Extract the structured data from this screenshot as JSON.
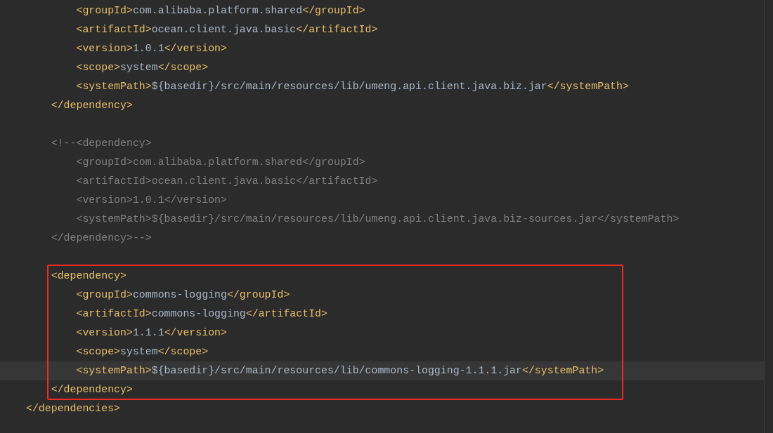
{
  "editor": {
    "blocks": [
      {
        "highlighted": false,
        "lines": [
          {
            "kind": "code",
            "text": "        <groupId>com.alibaba.platform.shared</groupId>"
          },
          {
            "kind": "code",
            "text": "        <artifactId>ocean.client.java.basic</artifactId>"
          },
          {
            "kind": "code",
            "text": "        <version>1.0.1</version>"
          },
          {
            "kind": "code",
            "text": "        <scope>system</scope>"
          },
          {
            "kind": "code",
            "text": "        <systemPath>${basedir}/src/main/resources/lib/umeng.api.client.java.biz.jar</systemPath>"
          },
          {
            "kind": "code",
            "text": "    </dependency>"
          },
          {
            "kind": "blank"
          },
          {
            "kind": "comment",
            "text": "    <!--<dependency>"
          },
          {
            "kind": "comment",
            "text": "        <groupId>com.alibaba.platform.shared</groupId>"
          },
          {
            "kind": "comment",
            "text": "        <artifactId>ocean.client.java.basic</artifactId>"
          },
          {
            "kind": "comment",
            "text": "        <version>1.0.1</version>"
          },
          {
            "kind": "comment",
            "text": "        <systemPath>${basedir}/src/main/resources/lib/umeng.api.client.java.biz-sources.jar</systemPath>"
          },
          {
            "kind": "comment",
            "text": "    </dependency>-->"
          },
          {
            "kind": "blank"
          }
        ]
      },
      {
        "highlighted": true,
        "lines": [
          {
            "kind": "code",
            "text": "    <dependency>"
          },
          {
            "kind": "code",
            "text": "        <groupId>commons-logging</groupId>"
          },
          {
            "kind": "code",
            "text": "        <artifactId>commons-logging</artifactId>"
          },
          {
            "kind": "code",
            "text": "        <version>1.1.1</version>"
          },
          {
            "kind": "code",
            "text": "        <scope>system</scope>"
          },
          {
            "kind": "code",
            "current": true,
            "text": "        <systemPath>${basedir}/src/main/resources/lib/commons-logging-1.1.1.jar</systemPath>"
          },
          {
            "kind": "code",
            "text": "    </dependency>"
          }
        ]
      },
      {
        "highlighted": false,
        "lines": [
          {
            "kind": "code",
            "text": "</dependencies>"
          }
        ]
      }
    ]
  }
}
